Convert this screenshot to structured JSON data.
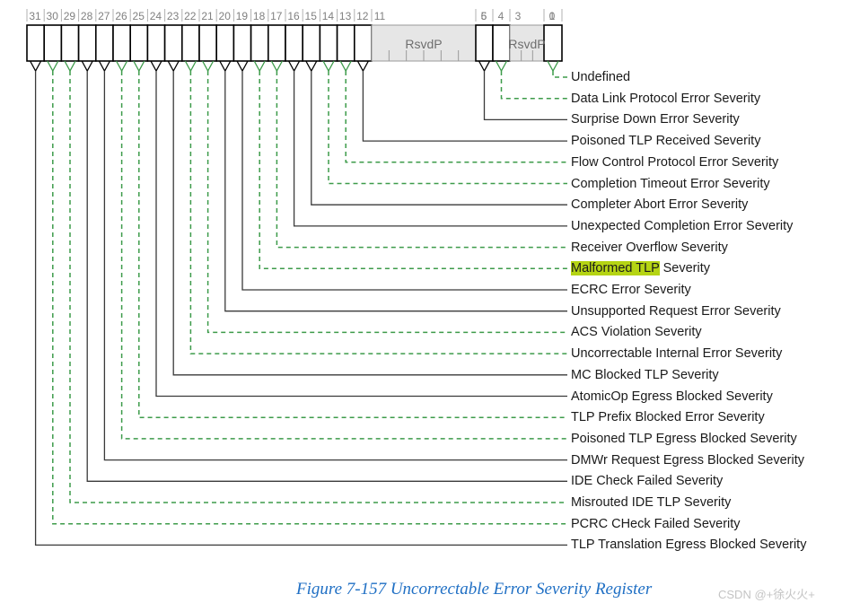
{
  "figure": {
    "caption": "Figure 7-157 Uncorrectable Error Severity Register",
    "watermark": "CSDN @+徐火火+",
    "caption_color": "#1f6fc4",
    "dash_color": "#3d9b4a",
    "solid_color": "#3a3a3a",
    "highlight_color": "#b5d414",
    "reserved_fill": "#e6e6e6"
  },
  "register": {
    "width_bits": 32,
    "reserved_label": "RsvdP",
    "bit_numbers": [
      "31",
      "30",
      "29",
      "28",
      "27",
      "26",
      "25",
      "24",
      "23",
      "22",
      "21",
      "20",
      "19",
      "18",
      "17",
      "16",
      "15",
      "14",
      "13",
      "12",
      "11",
      "6",
      "5",
      "4",
      "3",
      "1",
      "0"
    ],
    "fields": [
      {
        "bit": 31,
        "type": "cell"
      },
      {
        "bit": 30,
        "type": "cell"
      },
      {
        "bit": 29,
        "type": "cell"
      },
      {
        "bit": 28,
        "type": "cell"
      },
      {
        "bit": 27,
        "type": "cell"
      },
      {
        "bit": 26,
        "type": "cell"
      },
      {
        "bit": 25,
        "type": "cell"
      },
      {
        "bit": 24,
        "type": "cell"
      },
      {
        "bit": 23,
        "type": "cell"
      },
      {
        "bit": 22,
        "type": "cell"
      },
      {
        "bit": 21,
        "type": "cell"
      },
      {
        "bit": 20,
        "type": "cell"
      },
      {
        "bit": 19,
        "type": "cell"
      },
      {
        "bit": 18,
        "type": "cell"
      },
      {
        "bit": 17,
        "type": "cell"
      },
      {
        "bit": 16,
        "type": "cell"
      },
      {
        "bit": 15,
        "type": "cell"
      },
      {
        "bit": 14,
        "type": "cell"
      },
      {
        "bit": 13,
        "type": "cell"
      },
      {
        "bit": 12,
        "type": "cell"
      },
      {
        "bits": "11:6",
        "type": "reserved",
        "label": "RsvdP"
      },
      {
        "bit": 5,
        "type": "cell"
      },
      {
        "bit": 4,
        "type": "cell"
      },
      {
        "bits": "3:1",
        "type": "reserved",
        "label": "RsvdP"
      },
      {
        "bit": 0,
        "type": "cell"
      }
    ]
  },
  "callouts": [
    {
      "bit": 0,
      "label": "Undefined",
      "style": "dash",
      "highlight": null
    },
    {
      "bit": 4,
      "label": "Data Link Protocol Error Severity",
      "style": "dash",
      "highlight": null
    },
    {
      "bit": 5,
      "label": "Surprise Down Error Severity",
      "style": "solid",
      "highlight": null
    },
    {
      "bit": 12,
      "label": "Poisoned TLP Received Severity",
      "style": "solid",
      "highlight": null
    },
    {
      "bit": 13,
      "label": "Flow Control Protocol Error Severity",
      "style": "dash",
      "highlight": null
    },
    {
      "bit": 14,
      "label": "Completion Timeout Error Severity",
      "style": "dash",
      "highlight": null
    },
    {
      "bit": 15,
      "label": "Completer Abort Error Severity",
      "style": "solid",
      "highlight": null
    },
    {
      "bit": 16,
      "label": "Unexpected Completion Error Severity",
      "style": "solid",
      "highlight": null
    },
    {
      "bit": 17,
      "label": "Receiver Overflow Severity",
      "style": "dash",
      "highlight": null
    },
    {
      "bit": 18,
      "label": "Malformed TLP Severity",
      "style": "dash",
      "highlight": "Malformed TLP"
    },
    {
      "bit": 19,
      "label": "ECRC Error Severity",
      "style": "solid",
      "highlight": null
    },
    {
      "bit": 20,
      "label": "Unsupported Request Error Severity",
      "style": "solid",
      "highlight": null
    },
    {
      "bit": 21,
      "label": "ACS Violation Severity",
      "style": "dash",
      "highlight": null
    },
    {
      "bit": 22,
      "label": "Uncorrectable Internal Error Severity",
      "style": "dash",
      "highlight": null
    },
    {
      "bit": 23,
      "label": "MC Blocked TLP Severity",
      "style": "solid",
      "highlight": null
    },
    {
      "bit": 24,
      "label": "AtomicOp Egress Blocked Severity",
      "style": "solid",
      "highlight": null
    },
    {
      "bit": 25,
      "label": "TLP Prefix Blocked Error Severity",
      "style": "dash",
      "highlight": null
    },
    {
      "bit": 26,
      "label": "Poisoned TLP Egress Blocked Severity",
      "style": "dash",
      "highlight": null
    },
    {
      "bit": 27,
      "label": "DMWr Request Egress Blocked Severity",
      "style": "solid",
      "highlight": null
    },
    {
      "bit": 28,
      "label": "IDE Check Failed Severity",
      "style": "solid",
      "highlight": null
    },
    {
      "bit": 29,
      "label": "Misrouted IDE TLP Severity",
      "style": "dash",
      "highlight": null
    },
    {
      "bit": 30,
      "label": "PCRC CHeck Failed Severity",
      "style": "dash",
      "highlight": null
    },
    {
      "bit": 31,
      "label": "TLP Translation Egress Blocked Severity",
      "style": "solid",
      "highlight": null
    }
  ]
}
